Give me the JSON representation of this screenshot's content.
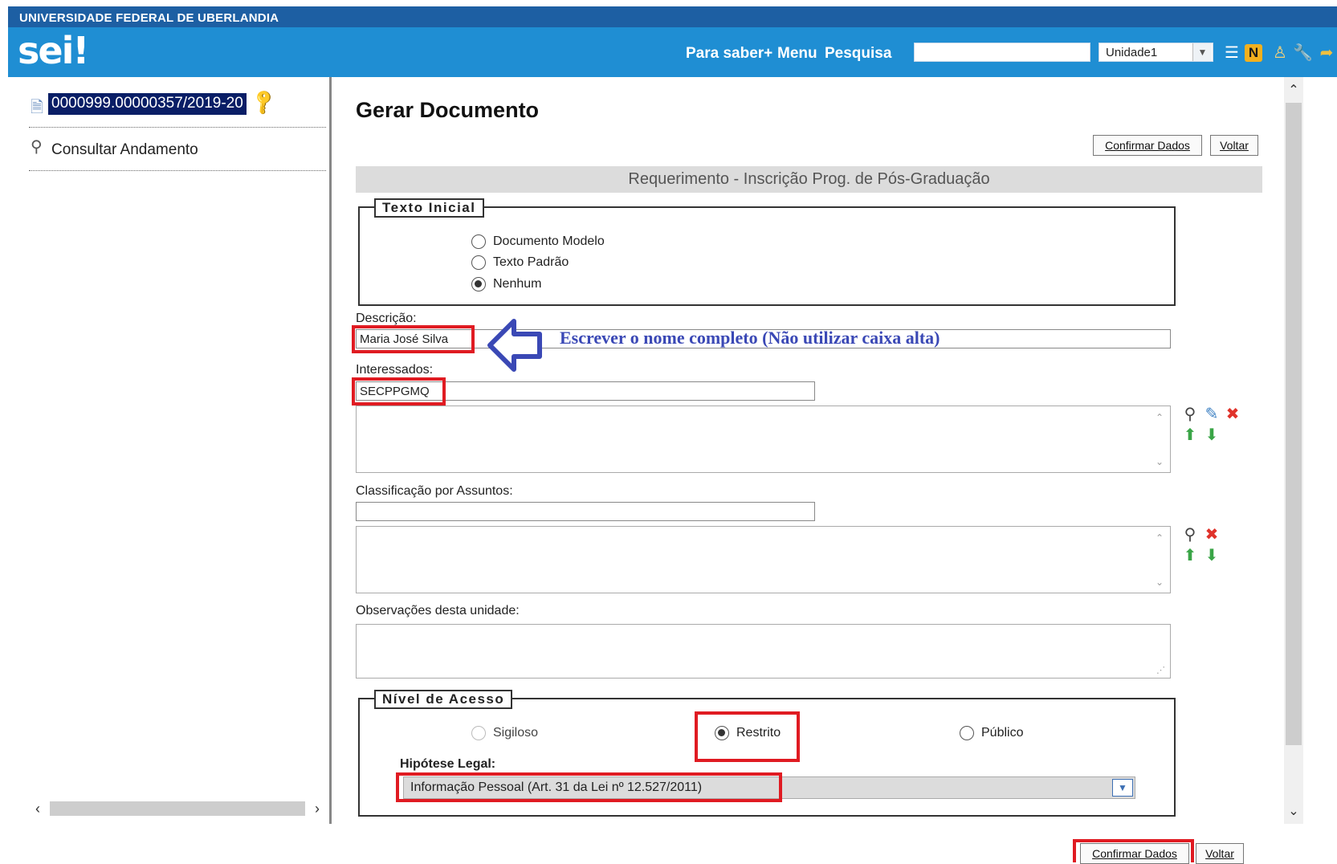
{
  "header": {
    "institution": "UNIVERSIDADE FEDERAL DE UBERLANDIA",
    "logo": "sei!",
    "links": [
      "Para saber+",
      "Menu",
      "Pesquisa"
    ],
    "search_value": "",
    "unit": "Unidade1",
    "icons": [
      "list-icon",
      "notes-icon",
      "user-icon",
      "wrench-icon",
      "exit-icon"
    ]
  },
  "left": {
    "process_number": "0000999.00000357/2019-20",
    "consult_label": "Consultar Andamento"
  },
  "main": {
    "title": "Gerar Documento",
    "confirm_label": "Confirmar Dados",
    "back_label": "Voltar",
    "doc_type": "Requerimento - Inscrição Prog. de Pós-Graduação",
    "texto_inicial": {
      "legend": "Texto Inicial",
      "options": [
        "Documento Modelo",
        "Texto Padrão",
        "Nenhum"
      ],
      "selected": "Nenhum"
    },
    "descricao_label": "Descrição:",
    "descricao_value": "Maria José Silva",
    "instruction": "Escrever o nome completo (Não utilizar caixa alta)",
    "interessados_label": "Interessados:",
    "interessados_value": "SECPPGMQ",
    "classificacao_label": "Classificação por Assuntos:",
    "observacoes_label": "Observações desta unidade:",
    "nivel_acesso": {
      "legend": "Nível de Acesso",
      "options": [
        "Sigiloso",
        "Restrito",
        "Público"
      ],
      "selected": "Restrito"
    },
    "hipotese_label": "Hipótese Legal:",
    "hipotese_value": "Informação Pessoal (Art. 31 da Lei nº 12.527/2011)"
  },
  "colors": {
    "header_dark": "#1d5fa3",
    "header_main": "#1f8ed3",
    "highlight_red": "#e01b22",
    "instruction_blue": "#3a48b5",
    "process_bg": "#0a1e66"
  }
}
